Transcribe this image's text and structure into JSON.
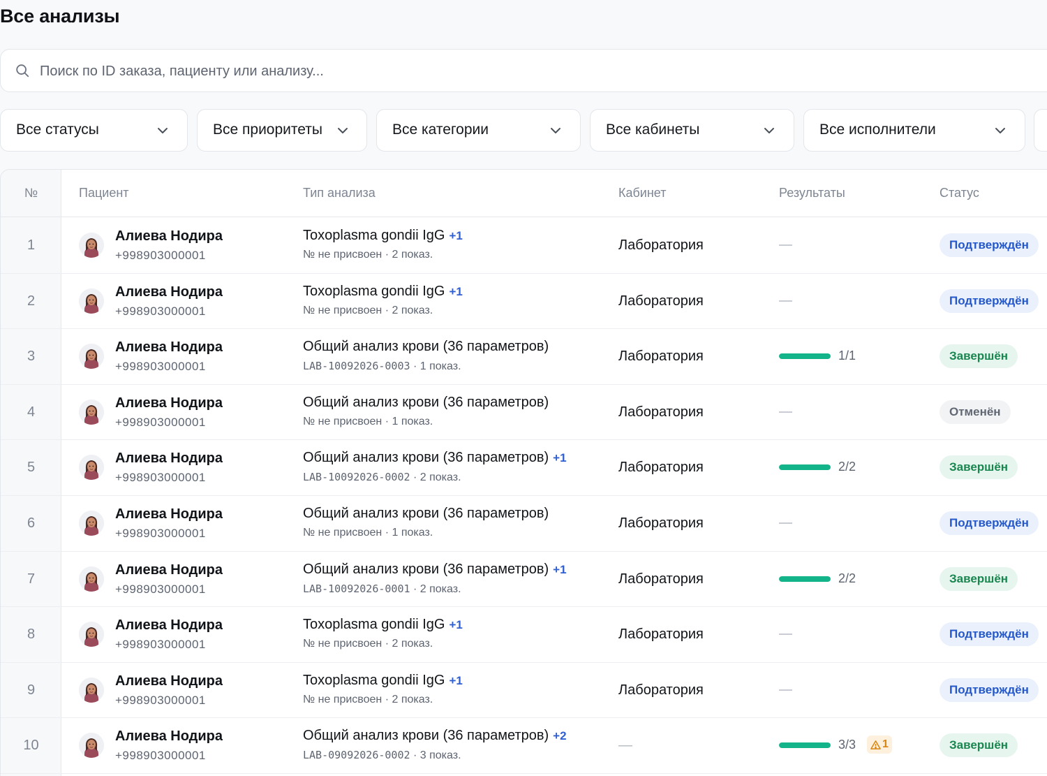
{
  "page": {
    "title": "Все анализы"
  },
  "search": {
    "placeholder": "Поиск по ID заказа, пациенту или анализу..."
  },
  "filters": [
    {
      "label": "Все статусы"
    },
    {
      "label": "Все приоритеты"
    },
    {
      "label": "Все категории"
    },
    {
      "label": "Все кабинеты"
    },
    {
      "label": "Все исполнители"
    }
  ],
  "table": {
    "columns": {
      "num": "№",
      "patient": "Пациент",
      "test": "Тип анализа",
      "cabinet": "Кабинет",
      "results": "Результаты",
      "status": "Статус"
    },
    "rows": [
      {
        "num": "1",
        "patient": "Алиева Нодира",
        "phone": "+998903000001",
        "test": "Toxoplasma gondii IgG",
        "extra": "+1",
        "code": "№ не присвоен",
        "count": "· 2 показ.",
        "cabinet": "Лаборатория",
        "results": null,
        "status": "Подтверждён",
        "status_kind": "confirmed"
      },
      {
        "num": "2",
        "patient": "Алиева Нодира",
        "phone": "+998903000001",
        "test": "Toxoplasma gondii IgG",
        "extra": "+1",
        "code": "№ не присвоен",
        "count": "· 2 показ.",
        "cabinet": "Лаборатория",
        "results": null,
        "status": "Подтверждён",
        "status_kind": "confirmed"
      },
      {
        "num": "3",
        "patient": "Алиева Нодира",
        "phone": "+998903000001",
        "test": "Общий анализ крови (36 параметров)",
        "extra": "",
        "code": "LAB-10092026-0003",
        "count": "· 1 показ.",
        "cabinet": "Лаборатория",
        "results": {
          "text": "1/1",
          "progress": 1.0
        },
        "status": "Завершён",
        "status_kind": "done"
      },
      {
        "num": "4",
        "patient": "Алиева Нодира",
        "phone": "+998903000001",
        "test": "Общий анализ крови (36 параметров)",
        "extra": "",
        "code": "№ не присвоен",
        "count": "· 1 показ.",
        "cabinet": "Лаборатория",
        "results": null,
        "status": "Отменён",
        "status_kind": "cancelled"
      },
      {
        "num": "5",
        "patient": "Алиева Нодира",
        "phone": "+998903000001",
        "test": "Общий анализ крови (36 параметров)",
        "extra": "+1",
        "code": "LAB-10092026-0002",
        "count": "· 2 показ.",
        "cabinet": "Лаборатория",
        "results": {
          "text": "2/2",
          "progress": 1.0
        },
        "status": "Завершён",
        "status_kind": "done"
      },
      {
        "num": "6",
        "patient": "Алиева Нодира",
        "phone": "+998903000001",
        "test": "Общий анализ крови (36 параметров)",
        "extra": "",
        "code": "№ не присвоен",
        "count": "· 1 показ.",
        "cabinet": "Лаборатория",
        "results": null,
        "status": "Подтверждён",
        "status_kind": "confirmed"
      },
      {
        "num": "7",
        "patient": "Алиева Нодира",
        "phone": "+998903000001",
        "test": "Общий анализ крови (36 параметров)",
        "extra": "+1",
        "code": "LAB-10092026-0001",
        "count": "· 2 показ.",
        "cabinet": "Лаборатория",
        "results": {
          "text": "2/2",
          "progress": 1.0
        },
        "status": "Завершён",
        "status_kind": "done"
      },
      {
        "num": "8",
        "patient": "Алиева Нодира",
        "phone": "+998903000001",
        "test": "Toxoplasma gondii IgG",
        "extra": "+1",
        "code": "№ не присвоен",
        "count": "· 2 показ.",
        "cabinet": "Лаборатория",
        "results": null,
        "status": "Подтверждён",
        "status_kind": "confirmed"
      },
      {
        "num": "9",
        "patient": "Алиева Нодира",
        "phone": "+998903000001",
        "test": "Toxoplasma gondii IgG",
        "extra": "+1",
        "code": "№ не присвоен",
        "count": "· 2 показ.",
        "cabinet": "Лаборатория",
        "results": null,
        "status": "Подтверждён",
        "status_kind": "confirmed"
      },
      {
        "num": "10",
        "patient": "Алиева Нодира",
        "phone": "+998903000001",
        "test": "Общий анализ крови (36 параметров)",
        "extra": "+2",
        "code": "LAB-09092026-0002",
        "count": "· 3 показ.",
        "cabinet": "—",
        "results": {
          "text": "3/3",
          "progress": 1.0,
          "warning": "1"
        },
        "status": "Завершён",
        "status_kind": "done"
      }
    ]
  },
  "colors": {
    "accent_blue": "#2457c9",
    "success_green": "#14b48b",
    "warning_orange": "#d98512"
  }
}
